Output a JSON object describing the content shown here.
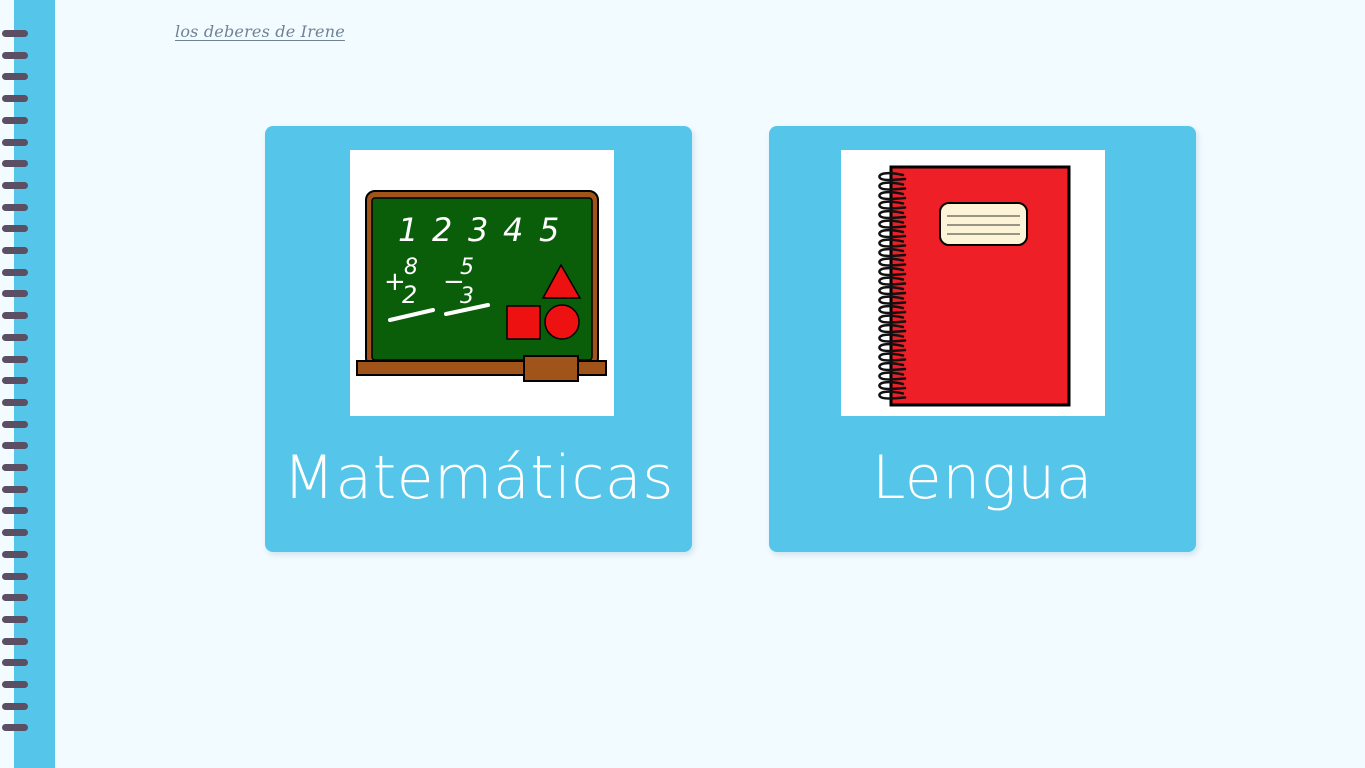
{
  "site": {
    "title": "los deberes de Irene"
  },
  "cards": [
    {
      "label": "Matemáticas",
      "icon": "chalkboard-icon"
    },
    {
      "label": "Lengua",
      "icon": "notebook-icon"
    }
  ],
  "chalkboard": {
    "numbers": [
      "1",
      "2",
      "3",
      "4",
      "5"
    ],
    "sum": {
      "op": "+",
      "top": "8",
      "bottom": "2"
    },
    "difference": {
      "op": "−",
      "top": "5",
      "bottom": "3"
    }
  },
  "colors": {
    "background": "#f2fbff",
    "card": "#55c5ea",
    "spine": "#55c5ea",
    "rings": "#5c4e63",
    "chalkboard_green": "#0a5e0a",
    "chalkboard_frame": "#a0541a",
    "notebook_red": "#ee1f26",
    "shape_red": "#ee1111"
  }
}
